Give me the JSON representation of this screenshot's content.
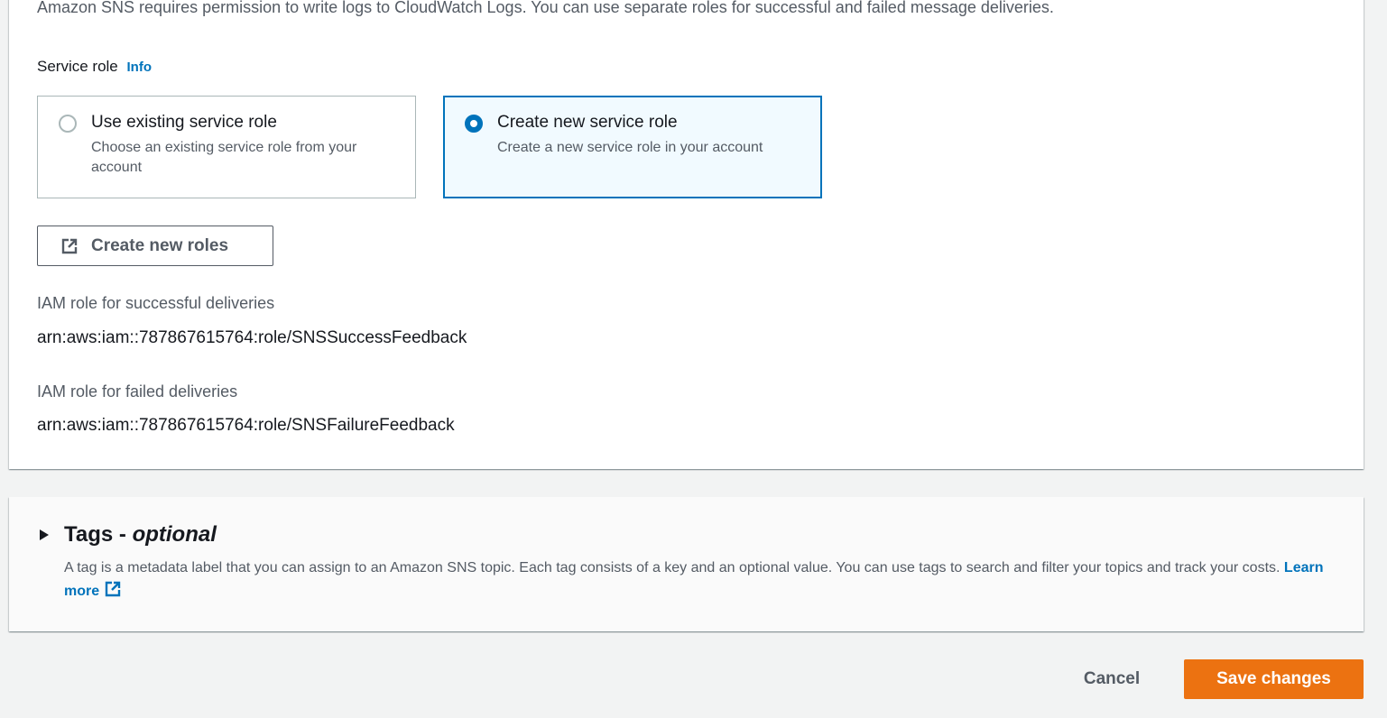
{
  "logging": {
    "description": "Amazon SNS requires permission to write logs to CloudWatch Logs. You can use separate roles for successful and failed message deliveries.",
    "service_role_label": "Service role",
    "info_link": "Info",
    "options": [
      {
        "title": "Use existing service role",
        "description": "Choose an existing service role from your account",
        "selected": false
      },
      {
        "title": "Create new service role",
        "description": "Create a new service role in your account",
        "selected": true
      }
    ],
    "create_roles_button": "Create new roles",
    "success_role": {
      "label": "IAM role for successful deliveries",
      "value": "arn:aws:iam::787867615764:role/SNSSuccessFeedback"
    },
    "failure_role": {
      "label": "IAM role for failed deliveries",
      "value": "arn:aws:iam::787867615764:role/SNSFailureFeedback"
    }
  },
  "tags": {
    "title": "Tags -",
    "title_optional": "optional",
    "description": "A tag is a metadata label that you can assign to an Amazon SNS topic. Each tag consists of a key and an optional value. You can use tags to search and filter your topics and track your costs.",
    "learn_more": "Learn more",
    "expanded": false
  },
  "footer": {
    "cancel_label": "Cancel",
    "save_label": "Save changes"
  },
  "colors": {
    "primary_button": "#ec7211",
    "link": "#0073bb",
    "selected_border": "#0073bb",
    "selected_background": "#f1faff"
  },
  "icons": {
    "create_roles": "external-link-icon",
    "learn_more": "external-link-icon",
    "tags_toggle": "caret-right-icon"
  }
}
